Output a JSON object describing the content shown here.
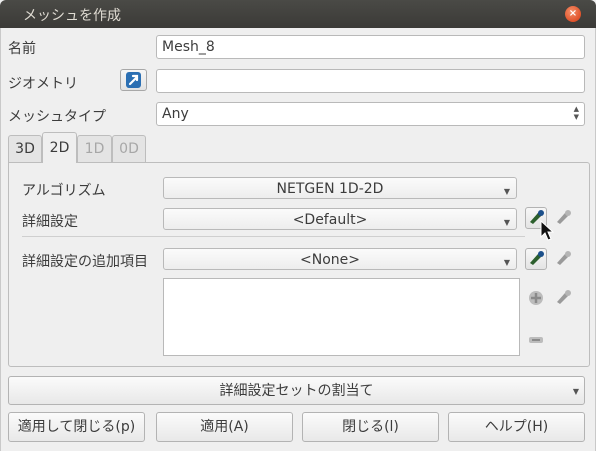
{
  "window": {
    "title": "メッシュを作成",
    "close_glyph": "×"
  },
  "form": {
    "name_label": "名前",
    "name_value": "Mesh_8",
    "geometry_label": "ジオメトリ",
    "geometry_value": "",
    "mesh_type_label": "メッシュタイプ",
    "mesh_type_value": "Any"
  },
  "tabs": [
    {
      "label": "3D",
      "state": "normal"
    },
    {
      "label": "2D",
      "state": "active"
    },
    {
      "label": "1D",
      "state": "disabled"
    },
    {
      "label": "0D",
      "state": "disabled"
    }
  ],
  "panel": {
    "algorithm_label": "アルゴリズム",
    "algorithm_value": "NETGEN 1D-2D",
    "hypothesis_label": "詳細設定",
    "hypothesis_value": "<Default>",
    "add_hyp_label": "詳細設定の追加項目",
    "add_hyp_value": "<None>",
    "add_hyp_list": []
  },
  "hyp_set_button": "詳細設定セットの割当て",
  "buttons": {
    "apply_close": "適用して閉じる(p)",
    "apply": "適用(A)",
    "close": "閉じる(l)",
    "help": "ヘルプ(H)"
  },
  "colors": {
    "titlebar": "#3c3b37",
    "close": "#e0522a",
    "accent": "#1b4f8a"
  }
}
